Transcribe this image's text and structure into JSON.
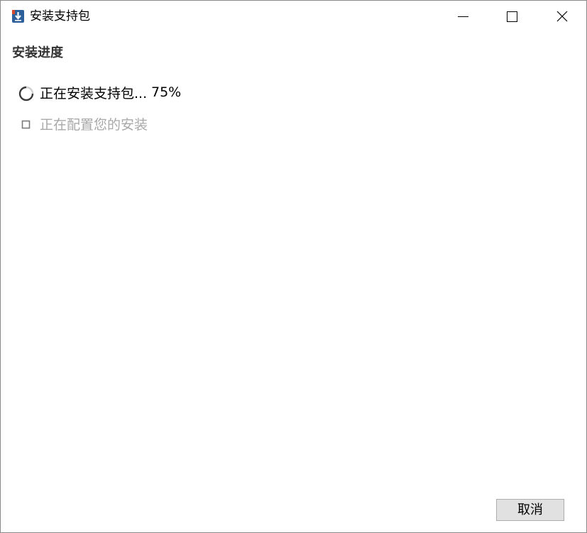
{
  "window": {
    "title": "安装支持包",
    "icon": "download-package-icon",
    "controls": {
      "minimize_icon": "minimize-icon",
      "maximize_icon": "maximize-icon",
      "close_icon": "close-icon"
    }
  },
  "section": {
    "title": "安装进度"
  },
  "steps": [
    {
      "label": "正在安装支持包...",
      "percent": "75%",
      "status": "in-progress",
      "icon": "spinner-icon"
    },
    {
      "label": "正在配置您的安装",
      "status": "pending",
      "icon": "pending-square-icon"
    }
  ],
  "footer": {
    "cancel_label": "取消"
  },
  "colors": {
    "active_text": "#000000",
    "pending_text": "#a8a8a8",
    "heading_text": "#333333",
    "button_bg": "#e1e1e1",
    "button_border": "#adadad",
    "window_border": "#8a8a8a"
  }
}
